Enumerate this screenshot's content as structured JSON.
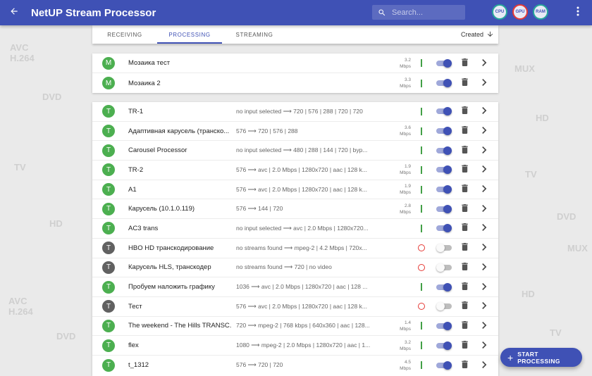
{
  "app": {
    "title": "NetUP Stream Processor",
    "colors": {
      "primary": "#3f51b5",
      "status_ok": "#43a047",
      "status_error": "#e53935",
      "avatar_active": "#4caf50",
      "avatar_inactive": "#616161"
    }
  },
  "search": {
    "placeholder": "Search..."
  },
  "gauges": {
    "cpu": "CPU",
    "gpu": "GPU",
    "ram": "RAM"
  },
  "tabs": [
    {
      "label": "RECEIVING"
    },
    {
      "label": "PROCESSING",
      "active": true
    },
    {
      "label": "STREAMING"
    }
  ],
  "sort": {
    "label": "Created"
  },
  "mosaic_rows": [
    {
      "letter": "M",
      "name": "Мозаика тест",
      "desc": "",
      "rate": "3.2\nMbps",
      "status": "ok",
      "enabled": true,
      "active": true
    },
    {
      "letter": "M",
      "name": "Мозаика 2",
      "desc": "",
      "rate": "3.3\nMbps",
      "status": "ok",
      "enabled": true,
      "active": true
    }
  ],
  "transcoder_rows": [
    {
      "letter": "T",
      "name": "TR-1",
      "desc": "no input selected ⟶ 720 | 576 | 288 | 720 | 720",
      "rate": "",
      "status": "ok",
      "enabled": true,
      "active": true
    },
    {
      "letter": "T",
      "name": "Адаптивная карусель (транско...",
      "desc": "576 ⟶ 720 | 576 | 288",
      "rate": "3.6\nMbps",
      "status": "ok",
      "enabled": true,
      "active": true
    },
    {
      "letter": "T",
      "name": "Carousel Processor",
      "desc": "no input selected ⟶ 480 | 288 | 144 | 720 | byp...",
      "rate": "",
      "status": "ok",
      "enabled": true,
      "active": true
    },
    {
      "letter": "T",
      "name": "TR-2",
      "desc": "576 ⟶ avc | 2.0 Mbps | 1280x720 | aac | 128 k...",
      "rate": "1.9\nMbps",
      "status": "ok",
      "enabled": true,
      "active": true
    },
    {
      "letter": "T",
      "name": "A1",
      "desc": "576 ⟶ avc | 2.0 Mbps | 1280x720 | aac | 128 k...",
      "rate": "1.9\nMbps",
      "status": "ok",
      "enabled": true,
      "active": true
    },
    {
      "letter": "T",
      "name": "Карусель (10.1.0.119)",
      "desc": "576 ⟶ 144 | 720",
      "rate": "2.8\nMbps",
      "status": "ok",
      "enabled": true,
      "active": true
    },
    {
      "letter": "T",
      "name": "AC3 trans",
      "desc": "no input selected ⟶ avc | 2.0 Mbps | 1280x720...",
      "rate": "",
      "status": "ok",
      "enabled": true,
      "active": true
    },
    {
      "letter": "T",
      "name": "HBO HD транскодирование",
      "desc": "no streams found ⟶ mpeg-2 | 4.2 Mbps | 720x...",
      "rate": "",
      "status": "error",
      "enabled": false,
      "active": false
    },
    {
      "letter": "T",
      "name": "Карусель HLS, транскодер",
      "desc": "no streams found ⟶ 720 | no video",
      "rate": "",
      "status": "error",
      "enabled": false,
      "active": false
    },
    {
      "letter": "T",
      "name": "Пробуем наложить графику",
      "desc": "1036 ⟶ avc | 2.0 Mbps | 1280x720 | aac | 128 ...",
      "rate": "",
      "status": "ok",
      "enabled": true,
      "active": true
    },
    {
      "letter": "T",
      "name": "Тест",
      "desc": "576 ⟶ avc | 2.0 Mbps | 1280x720 | aac | 128 k...",
      "rate": "",
      "status": "error",
      "enabled": false,
      "active": false
    },
    {
      "letter": "T",
      "name": "The weekend - The Hills TRANSC...",
      "desc": "720 ⟶ mpeg-2 | 768 kbps | 640x360 | aac | 128...",
      "rate": "1.4\nMbps",
      "status": "ok",
      "enabled": true,
      "active": true
    },
    {
      "letter": "T",
      "name": "flex",
      "desc": "1080 ⟶ mpeg-2 | 2.0 Mbps | 1280x720 | aac | 1...",
      "rate": "3.2\nMbps",
      "status": "ok",
      "enabled": true,
      "active": true
    },
    {
      "letter": "T",
      "name": "t_1312",
      "desc": "576 ⟶ 720 | 720",
      "rate": "4.5\nMbps",
      "status": "ok",
      "enabled": true,
      "active": true
    }
  ],
  "fab": {
    "label": "START PROCESSING"
  },
  "icons": {
    "back": "arrow-back-icon",
    "search": "search-icon",
    "more": "more-vert-icon",
    "sort": "arrow-down-icon",
    "delete": "trash-icon",
    "open": "chevron-right-icon",
    "add": "plus-icon"
  }
}
